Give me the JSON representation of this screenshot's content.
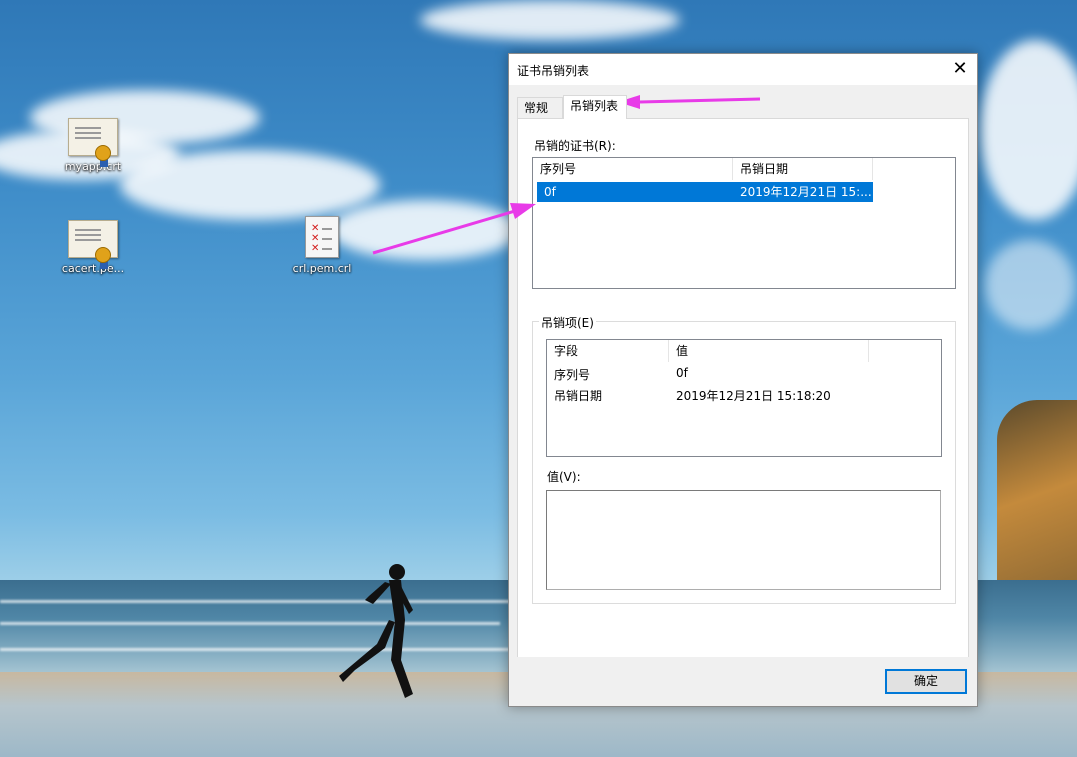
{
  "desktop": {
    "icons": [
      {
        "caption": "myapp.crt",
        "type": "certificate"
      },
      {
        "caption": "cacert.pe...",
        "type": "certificate"
      },
      {
        "caption": "crl.pem.crl",
        "type": "crl"
      }
    ]
  },
  "dialog": {
    "title": "证书吊销列表",
    "close_glyph": "✕",
    "tabs": [
      {
        "label": "常规",
        "active": false
      },
      {
        "label": "吊销列表",
        "active": true
      }
    ],
    "revoked": {
      "label": "吊销的证书(R):",
      "columns": [
        "序列号",
        "吊销日期"
      ],
      "rows": [
        {
          "serial": "0f",
          "date": "2019年12月21日 15:...",
          "selected": true
        }
      ]
    },
    "entry": {
      "group_label": "吊销项(E)",
      "columns": [
        "字段",
        "值"
      ],
      "rows": [
        {
          "field": "序列号",
          "value": "0f"
        },
        {
          "field": "吊销日期",
          "value": "2019年12月21日 15:18:20"
        }
      ],
      "value_label": "值(V):",
      "value_text": ""
    },
    "ok_label": "确定"
  },
  "colors": {
    "selection": "#0078d7",
    "annotation_arrow": "#e83be8"
  }
}
